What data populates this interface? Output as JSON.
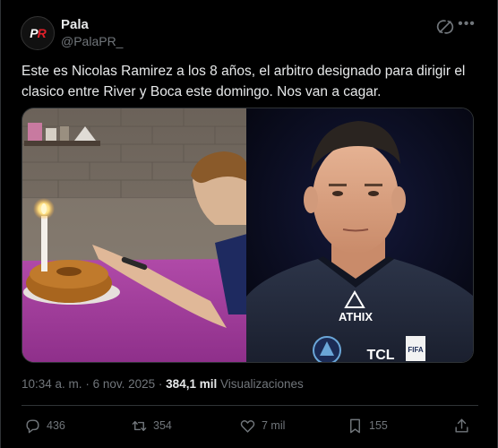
{
  "author": {
    "name": "Pala",
    "handle": "@PalaPR_",
    "avatar_text": "PR"
  },
  "tweet": {
    "text": "Este es Nicolas Ramirez a los 8 años, el arbitro designado para dirigir el clasico entre River y Boca este domingo. Nos van a cagar."
  },
  "media": {
    "right_photo": {
      "jersey_brand": "ATHIX",
      "sponsor": "TCL",
      "badge": "FIFA"
    }
  },
  "meta": {
    "time": "10:34 a. m.",
    "separator": "·",
    "date": "6 nov. 2025",
    "views_count": "384,1 mil",
    "views_label": "Visualizaciones"
  },
  "actions": {
    "replies": "436",
    "reposts": "354",
    "likes": "7 mil",
    "bookmarks": "155"
  },
  "icons": [
    "grok-icon",
    "more-icon",
    "reply-icon",
    "repost-icon",
    "like-icon",
    "bookmark-icon",
    "share-icon"
  ],
  "colors": {
    "background": "#000000",
    "text": "#e7e9ea",
    "muted": "#71767b",
    "border": "#2f3336"
  }
}
